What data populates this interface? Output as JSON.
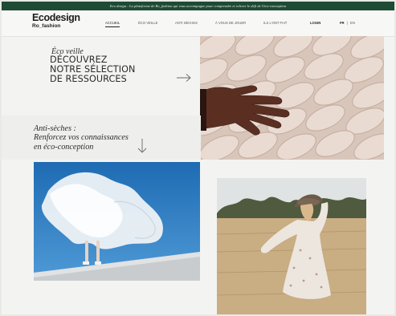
{
  "banner": {
    "text": "Eco design : La plateforme de Ro_fashion qui vous accompagne pour comprendre et relever le défi de l'éco-conception"
  },
  "header": {
    "logo_main": "Ecodesign",
    "logo_sub": "Ro_fashion",
    "nav": [
      "ACCUEIL",
      "ÉCO VEILLE",
      "ANTI SÈCHES",
      "À VOUS DE JOUER",
      "ILS L'ONT FAIT"
    ],
    "login": "LOGIN",
    "lang_current": "FR",
    "lang_sep": "|",
    "lang_other": "EN"
  },
  "hero": {
    "eyebrow": "Éco veille",
    "title_lines": [
      "DÉCOUVREZ",
      "NOTRE SÉLECTION",
      "DE RESSOURCES"
    ],
    "arrow_icon": "arrow-right-icon"
  },
  "anti": {
    "lines": [
      "Anti-sèches :",
      "Renforcez vos connaissances",
      "en éco-conception"
    ],
    "arrow_icon": "arrow-down-icon"
  },
  "colors": {
    "banner_bg": "#1f4b35",
    "page_bg": "#f3f3f1",
    "text": "#2b2b2b"
  }
}
